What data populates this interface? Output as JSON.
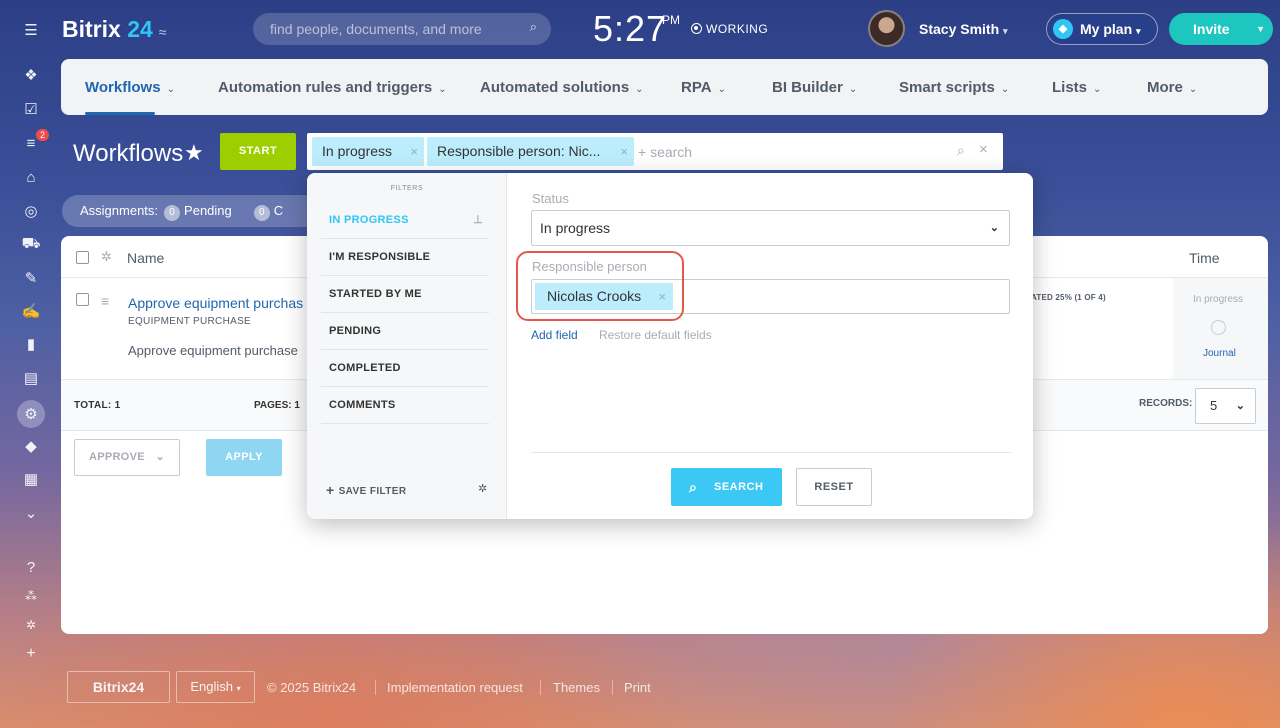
{
  "topbar": {
    "logo_word": "Bitrix",
    "logo_num": "24",
    "search_placeholder": "find people, documents, and more",
    "clock_time": "5:27",
    "clock_ampm": "PM",
    "status": "WORKING",
    "user_name": "Stacy Smith",
    "plan_label": "My plan",
    "invite_label": "Invite"
  },
  "leftbar": {
    "notifications_count": "2"
  },
  "nav": {
    "items": [
      {
        "label": "Workflows"
      },
      {
        "label": "Automation rules and triggers"
      },
      {
        "label": "Automated solutions"
      },
      {
        "label": "RPA"
      },
      {
        "label": "BI Builder"
      },
      {
        "label": "Smart scripts"
      },
      {
        "label": "Lists"
      },
      {
        "label": "More"
      }
    ]
  },
  "page": {
    "title": "Workflows",
    "start_label": "START"
  },
  "filter_bar": {
    "chips": [
      "In progress",
      "Responsible person: Nic..."
    ],
    "placeholder": "+ search"
  },
  "assignments": {
    "label": "Assignments:",
    "pending_count": "0",
    "pending_label": "Pending",
    "other_count": "0",
    "other_label": "C"
  },
  "grid": {
    "col_name": "Name",
    "col_time": "Time",
    "row": {
      "title": "Approve equipment purchas",
      "type": "EQUIPMENT PURCHASE",
      "desc": "Approve equipment purchase",
      "status_text": "ATED 25% (1 OF 4)",
      "time_status": "In progress",
      "journal": "Journal"
    },
    "total_label": "TOTAL:",
    "total_value": "1",
    "pages_label": "PAGES:",
    "pages_value": "1",
    "records_label": "RECORDS:",
    "records_value": "5",
    "approve_label": "APPROVE",
    "apply_label": "APPLY"
  },
  "filter_popup": {
    "heading": "FILTERS",
    "presets": [
      "IN PROGRESS",
      "I'M RESPONSIBLE",
      "STARTED BY ME",
      "PENDING",
      "COMPLETED",
      "COMMENTS"
    ],
    "save_filter": "SAVE FILTER",
    "status_label": "Status",
    "status_value": "In progress",
    "responsible_label": "Responsible person",
    "responsible_value": "Nicolas Crooks",
    "add_field": "Add field",
    "restore_fields": "Restore default fields",
    "search_label": "SEARCH",
    "reset_label": "RESET"
  },
  "footer": {
    "logo": "Bitrix24",
    "language": "English",
    "copyright": "© 2025 Bitrix24",
    "links": [
      "Implementation request",
      "Themes",
      "Print"
    ]
  },
  "colors": {
    "accent": "#2067b0",
    "start_green": "#9dcf00",
    "chip_blue": "#bcedfc",
    "highlight_red": "#e4584c",
    "invite": "#1ec6c0"
  }
}
